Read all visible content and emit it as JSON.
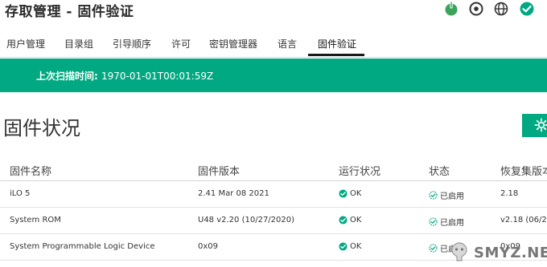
{
  "header": {
    "title": "存取管理 - 固件验证",
    "icons": [
      "power-icon",
      "location-icon",
      "globe-icon",
      "health-ok-icon"
    ]
  },
  "tabs": [
    {
      "label": "用户管理",
      "active": false
    },
    {
      "label": "目录组",
      "active": false
    },
    {
      "label": "引导顺序",
      "active": false
    },
    {
      "label": "许可",
      "active": false
    },
    {
      "label": "密钥管理器",
      "active": false
    },
    {
      "label": "语言",
      "active": false
    },
    {
      "label": "固件验证",
      "active": true
    }
  ],
  "banner": {
    "label": "上次扫描时间:",
    "value": "1970-01-01T00:01:59Z"
  },
  "section": {
    "title": "固件状况"
  },
  "table": {
    "columns": [
      "固件名称",
      "固件版本",
      "运行状况",
      "状态",
      "恢复集版本"
    ],
    "rows": [
      {
        "name": "iLO 5",
        "version": "2.41 Mar 08 2021",
        "health": "OK",
        "status": "已启用",
        "recovery": "2.18"
      },
      {
        "name": "System ROM",
        "version": "U48 v2.20 (10/27/2020)",
        "health": "OK",
        "status": "已启用",
        "recovery": "v2.18 (06/24/20"
      },
      {
        "name": "System Programmable Logic Device",
        "version": "0x09",
        "health": "OK",
        "status": "已启用",
        "recovery": "0x09"
      }
    ]
  },
  "watermark": {
    "text": "SMYZ.NET"
  },
  "colors": {
    "accent": "#01a982",
    "ok": "#01a982",
    "power": "#3aa35c"
  }
}
